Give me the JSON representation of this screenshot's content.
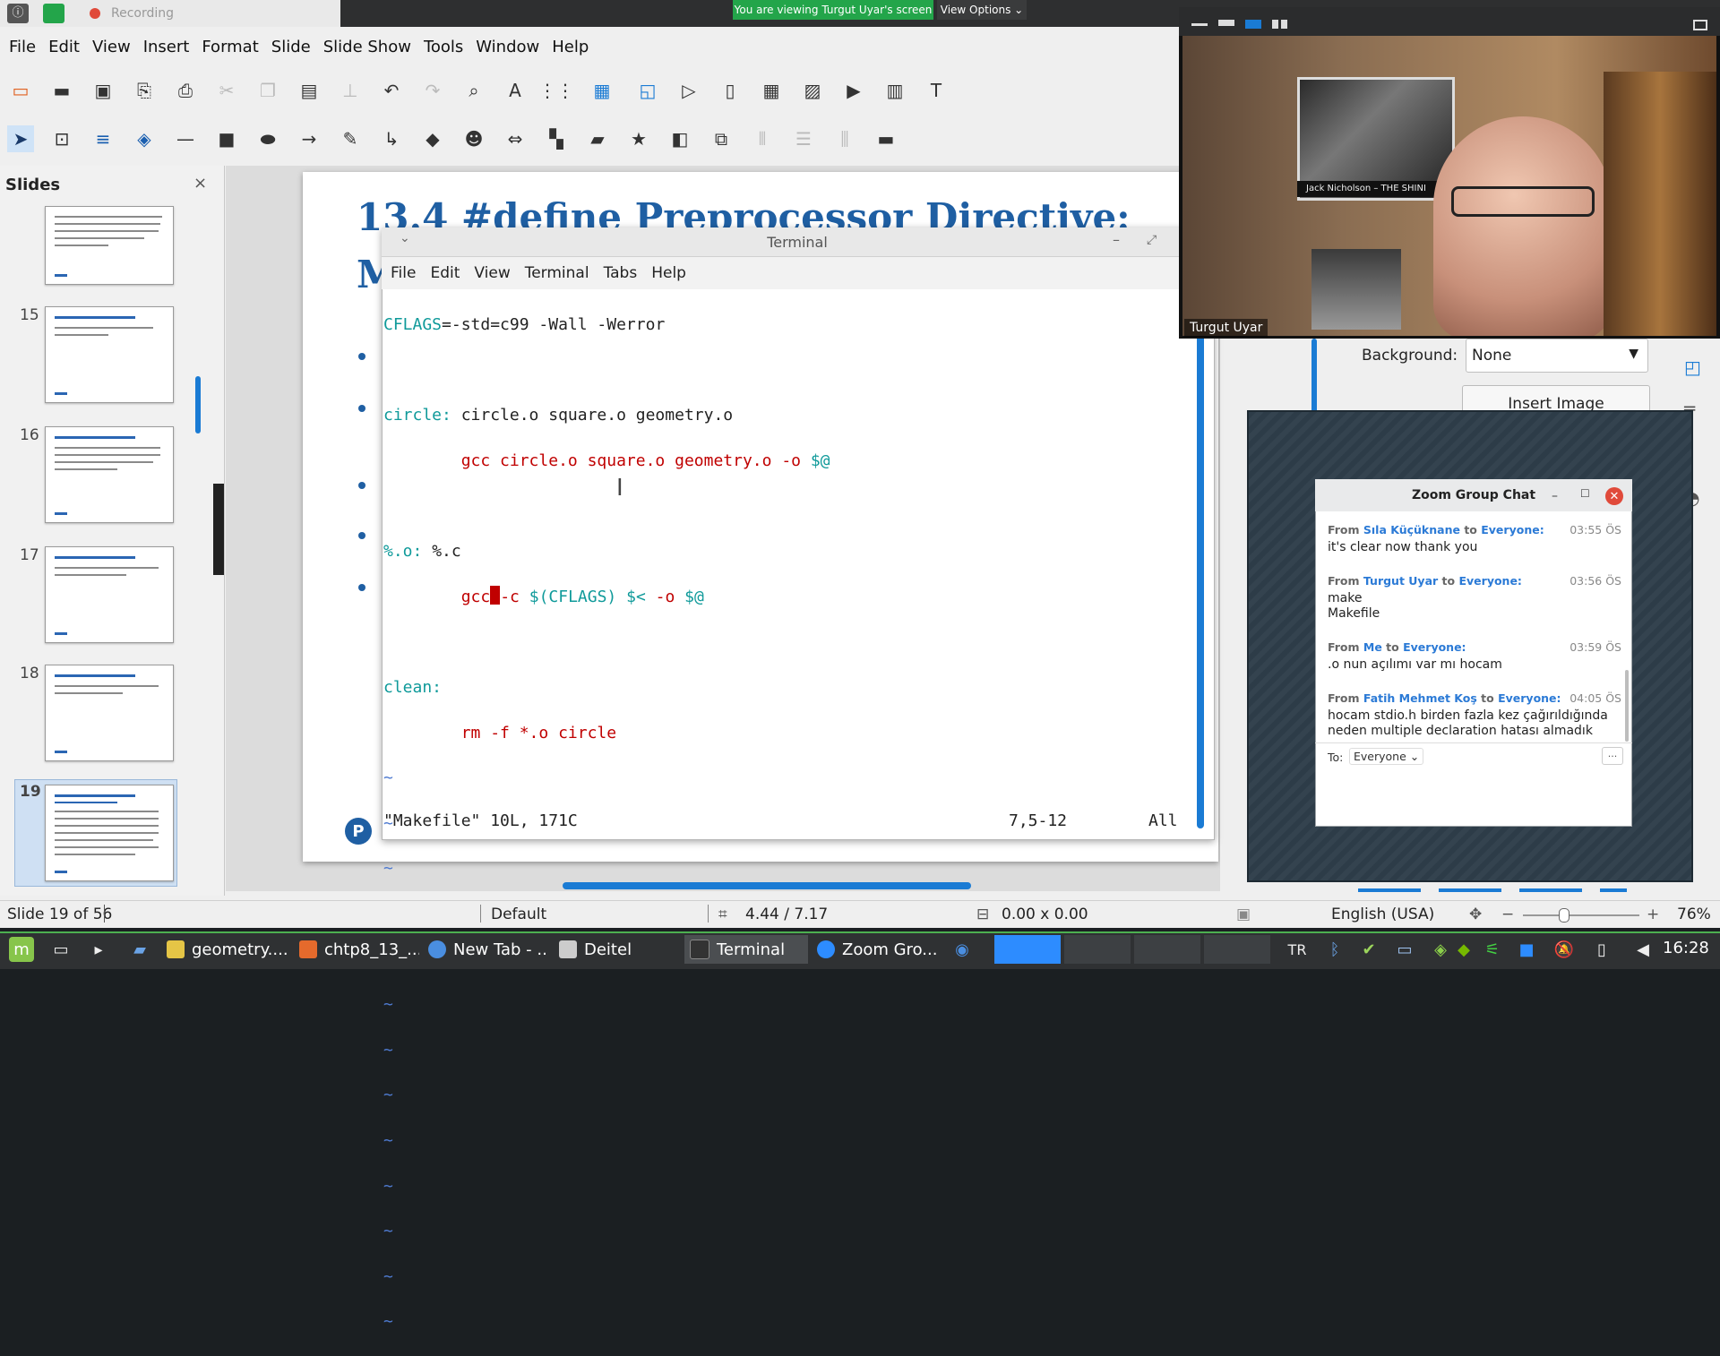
{
  "zoom_bar": {
    "recording_label": "Recording",
    "viewing_banner": "You are viewing Turgut Uyar's screen",
    "view_options": "View Options ⌄"
  },
  "lo": {
    "menu": [
      "File",
      "Edit",
      "View",
      "Insert",
      "Format",
      "Slide",
      "Slide Show",
      "Tools",
      "Window",
      "Help"
    ],
    "slides_panel_title": "Slides",
    "slide_numbers": [
      "15",
      "16",
      "17",
      "18",
      "19"
    ],
    "slide_title": "13.4 #define Preprocessor Directive:",
    "slide_title_line2": "M",
    "pearson_logo": "P",
    "sidebar": {
      "background_label": "Background:",
      "background_value": "None",
      "insert_image": "Insert Image"
    },
    "status": {
      "slide_of": "Slide 19 of 56",
      "master": "Default",
      "position": "4.44 / 7.17",
      "size": "0.00 x 0.00",
      "language": "English (USA)",
      "zoom": "76%"
    }
  },
  "terminal": {
    "title": "Terminal",
    "menu": [
      "File",
      "Edit",
      "View",
      "Terminal",
      "Tabs",
      "Help"
    ],
    "lines": {
      "l1_var": "CFLAGS",
      "l1_rest": "=-std=c99 -Wall -Werror",
      "l3_target": "circle:",
      "l3_deps": " circle.o square.o geometry.o",
      "l4_cmd": "        gcc circle.o square.o geometry.o -o ",
      "l4_auto": "$@",
      "l6_target": "%.o:",
      "l6_deps": " %.c",
      "l7_pre": "        gcc",
      "l7_cmd": "-c ",
      "l7_flags": "$(CFLAGS) $< ",
      "l7_o": "-o ",
      "l7_auto": "$@",
      "l9_target": "clean:",
      "l10_cmd": "        rm -f *.o circle"
    },
    "status_left": "\"Makefile\" 10L, 171C",
    "status_pos": "7,5-12",
    "status_all": "All"
  },
  "video": {
    "participant": "Turgut Uyar",
    "poster_caption": "Jack Nicholson – THE SHINI"
  },
  "chat": {
    "title": "Zoom Group Chat",
    "messages": [
      {
        "from_word": "From",
        "from": "Sıla Küçüknane",
        "to_word": "to",
        "to": "Everyone:",
        "time": "03:55 ÖS",
        "lines": [
          "it's clear now thank you"
        ]
      },
      {
        "from_word": "From",
        "from": "Turgut Uyar",
        "to_word": "to",
        "to": "Everyone:",
        "time": "03:56 ÖS",
        "lines": [
          "make",
          "Makefile"
        ]
      },
      {
        "from_word": "From",
        "from": "Me",
        "to_word": "to",
        "to": "Everyone:",
        "time": "03:59 ÖS",
        "lines": [
          ".o nun açılımı var mı hocam"
        ]
      },
      {
        "from_word": "From",
        "from": "Fatih Mehmet Koş",
        "to_word": "to",
        "to": "Everyone:",
        "time": "04:05 ÖS",
        "lines": [
          "hocam stdio.h birden fazla kez çağırıldığında",
          "neden multiple declaration hatası almadık"
        ]
      }
    ],
    "to_label": "To:",
    "to_value": "Everyone ⌄",
    "more": "···"
  },
  "taskbar": {
    "tasks": [
      "geometry....",
      "chtp8_13_...",
      "New Tab - ...",
      "Deitel",
      "Terminal",
      "Zoom Gro..."
    ],
    "lang": "TR",
    "clock": "16:28"
  },
  "colors": {
    "zoom_green": "#23a54a",
    "terminal_cyan": "#0f9a9a",
    "terminal_red": "#c00000",
    "accent_blue": "#1a7bd4",
    "chat_name_blue": "#2b7ad6"
  }
}
